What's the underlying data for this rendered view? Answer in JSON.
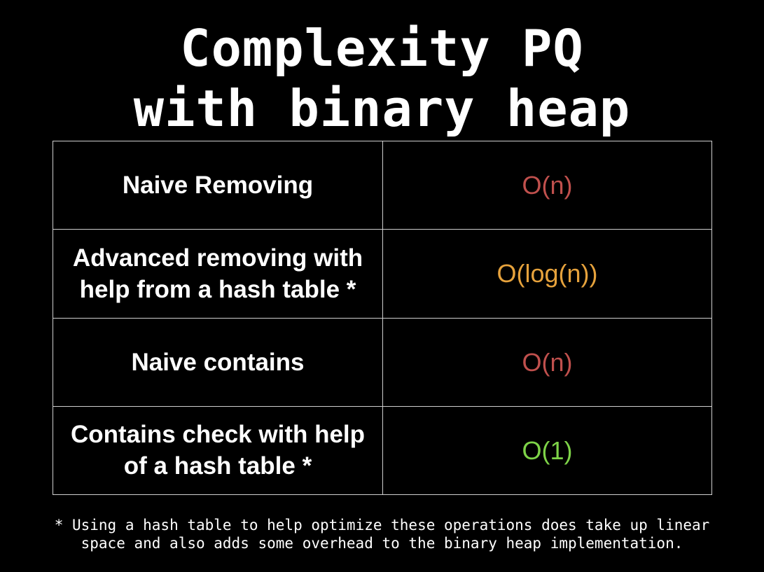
{
  "title": {
    "line1": "Complexity PQ",
    "line2": "with binary heap"
  },
  "colors": {
    "background": "#000000",
    "text": "#ffffff",
    "linear": "#c0504d",
    "logarithmic": "#e6a23c",
    "constant": "#7ed348",
    "border": "#cfcfcf"
  },
  "rows": [
    {
      "operation": "Naive Removing",
      "complexity": "O(n)",
      "color": "#c0504d"
    },
    {
      "operation": "Advanced removing with help from a hash table *",
      "complexity": "O(log(n))",
      "color": "#e6a23c"
    },
    {
      "operation": "Naive contains",
      "complexity": "O(n)",
      "color": "#c0504d"
    },
    {
      "operation": "Contains check with help of a hash table *",
      "complexity": "O(1)",
      "color": "#7ed348"
    }
  ],
  "footnote": {
    "line1": "* Using a hash table to help optimize these operations does take up linear",
    "line2": "space and also adds some overhead to the binary heap implementation."
  }
}
